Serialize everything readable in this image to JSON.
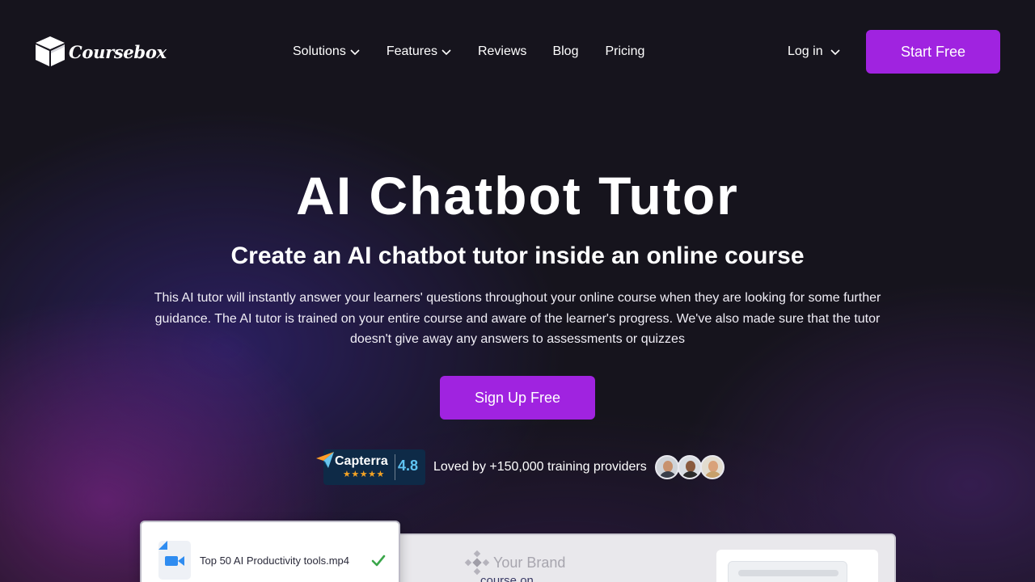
{
  "header": {
    "logo_text": "Coursebox",
    "nav": [
      {
        "label": "Solutions",
        "has_dropdown": true
      },
      {
        "label": "Features",
        "has_dropdown": true
      },
      {
        "label": "Reviews",
        "has_dropdown": false
      },
      {
        "label": "Blog",
        "has_dropdown": false
      },
      {
        "label": "Pricing",
        "has_dropdown": false
      }
    ],
    "login_label": "Log in",
    "cta_label": "Start Free"
  },
  "hero": {
    "title": "AI Chatbot Tutor",
    "subtitle": "Create an AI chatbot tutor inside an online course",
    "description": "This AI tutor will instantly answer your learners' questions throughout your online course when they are looking for some further guidance. The AI tutor is trained on your entire course and aware of the learner's progress. We've also made sure that the tutor doesn't give away any answers to assessments or quizzes",
    "cta_label": "Sign Up Free"
  },
  "social_proof": {
    "capterra_name": "Capterra",
    "capterra_stars": "★★★★★",
    "capterra_score": "4.8",
    "text": "Loved by +150,000 training providers",
    "avatars": [
      "avatar-1",
      "avatar-2",
      "avatar-3"
    ]
  },
  "preview": {
    "file_name": "Top 50 AI Productivity tools.mp4",
    "brand_label": "Your Brand",
    "course_label": "course on"
  },
  "colors": {
    "accent": "#a023e0",
    "background": "#16141d",
    "capterra_bg": "#0e2a47",
    "capterra_score": "#5fc3f2"
  }
}
